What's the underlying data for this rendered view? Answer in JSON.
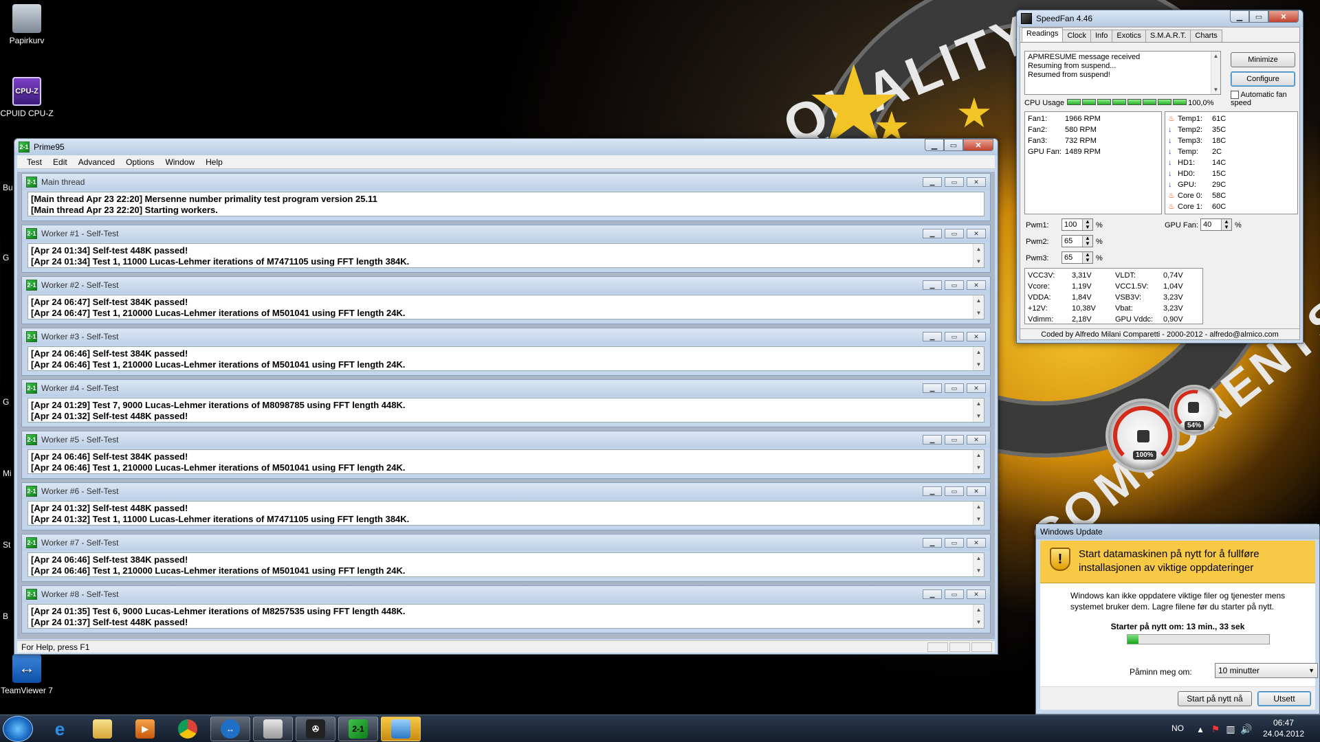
{
  "desktop": {
    "icons": [
      {
        "label": "Papirkurv",
        "icon": "recycle-bin-icon"
      },
      {
        "label": "CPUID CPU-Z",
        "icon": "cpuz-icon",
        "glyph": "CPU-Z"
      },
      {
        "label": "TeamViewer 7",
        "icon": "teamviewer-icon",
        "glyph": "↔"
      }
    ],
    "partial_labels": [
      "Bu",
      "G",
      "G",
      "Mi",
      "St",
      "B"
    ],
    "background_texts": [
      "QUALITY",
      "COMPONENTS"
    ]
  },
  "prime95": {
    "title": "Prime95",
    "app_glyph": "2-1",
    "menu": [
      "Test",
      "Edit",
      "Advanced",
      "Options",
      "Window",
      "Help"
    ],
    "status": "For Help, press F1",
    "windows": [
      {
        "title": "Main thread",
        "lines": [
          "[Main thread Apr 23 22:20] Mersenne number primality test program version 25.11",
          "[Main thread Apr 23 22:20] Starting workers."
        ]
      },
      {
        "title": "Worker #1 - Self-Test",
        "lines": [
          "[Apr 24 01:34] Self-test 448K passed!",
          "[Apr 24 01:34] Test 1, 11000 Lucas-Lehmer iterations of M7471105 using FFT length 384K."
        ]
      },
      {
        "title": "Worker #2 - Self-Test",
        "lines": [
          "[Apr 24 06:47] Self-test 384K passed!",
          "[Apr 24 06:47] Test 1, 210000 Lucas-Lehmer iterations of M501041 using FFT length 24K."
        ]
      },
      {
        "title": "Worker #3 - Self-Test",
        "lines": [
          "[Apr 24 06:46] Self-test 384K passed!",
          "[Apr 24 06:46] Test 1, 210000 Lucas-Lehmer iterations of M501041 using FFT length 24K."
        ]
      },
      {
        "title": "Worker #4 - Self-Test",
        "lines": [
          "[Apr 24 01:29] Test 7, 9000 Lucas-Lehmer iterations of M8098785 using FFT length 448K.",
          "[Apr 24 01:32] Self-test 448K passed!"
        ]
      },
      {
        "title": "Worker #5 - Self-Test",
        "lines": [
          "[Apr 24 06:46] Self-test 384K passed!",
          "[Apr 24 06:46] Test 1, 210000 Lucas-Lehmer iterations of M501041 using FFT length 24K."
        ]
      },
      {
        "title": "Worker #6 - Self-Test",
        "lines": [
          "[Apr 24 01:32] Self-test 448K passed!",
          "[Apr 24 01:32] Test 1, 11000 Lucas-Lehmer iterations of M7471105 using FFT length 384K."
        ]
      },
      {
        "title": "Worker #7 - Self-Test",
        "lines": [
          "[Apr 24 06:46] Self-test 384K passed!",
          "[Apr 24 06:46] Test 1, 210000 Lucas-Lehmer iterations of M501041 using FFT length 24K."
        ]
      },
      {
        "title": "Worker #8 - Self-Test",
        "lines": [
          "[Apr 24 01:35] Test 6, 9000 Lucas-Lehmer iterations of M8257535 using FFT length 448K.",
          "[Apr 24 01:37] Self-test 448K passed!"
        ]
      }
    ]
  },
  "speedfan": {
    "title": "SpeedFan 4.46",
    "tabs": [
      "Readings",
      "Clock",
      "Info",
      "Exotics",
      "S.M.A.R.T.",
      "Charts"
    ],
    "log": [
      "APMRESUME message received",
      "Resuming from suspend...",
      "Resumed from suspend!"
    ],
    "minimize_label": "Minimize",
    "configure_label": "Configure",
    "auto_fan_label": "Automatic fan speed",
    "cpu_usage_label": "CPU Usage",
    "cpu_usage_value": "100,0%",
    "cpu_usage_fraction": 1.0,
    "cpu_bars": 8,
    "fans": [
      {
        "name": "Fan1:",
        "value": "1966 RPM"
      },
      {
        "name": "Fan2:",
        "value": "580 RPM"
      },
      {
        "name": "Fan3:",
        "value": "732 RPM"
      },
      {
        "name": "GPU Fan:",
        "value": "1489 RPM"
      }
    ],
    "temps": [
      {
        "name": "Temp1:",
        "value": "61C",
        "trend": "flame-icon"
      },
      {
        "name": "Temp2:",
        "value": "35C",
        "trend": "down-arrow-icon"
      },
      {
        "name": "Temp3:",
        "value": "18C",
        "trend": "down-arrow-icon"
      },
      {
        "name": "Temp:",
        "value": "2C",
        "trend": "down-arrow-icon"
      },
      {
        "name": "HD1:",
        "value": "14C",
        "trend": "down-arrow-icon"
      },
      {
        "name": "HD0:",
        "value": "15C",
        "trend": "down-arrow-icon"
      },
      {
        "name": "GPU:",
        "value": "29C",
        "trend": "down-arrow-icon"
      },
      {
        "name": "Core 0:",
        "value": "58C",
        "trend": "flame-icon"
      },
      {
        "name": "Core 1:",
        "value": "60C",
        "trend": "flame-icon"
      }
    ],
    "pwm": [
      {
        "name": "Pwm1:",
        "value": "100",
        "unit": "%"
      },
      {
        "name": "Pwm2:",
        "value": "65",
        "unit": "%"
      },
      {
        "name": "Pwm3:",
        "value": "65",
        "unit": "%"
      }
    ],
    "gpu_fan": {
      "name": "GPU Fan:",
      "value": "40",
      "unit": "%"
    },
    "volts_left": [
      {
        "name": "VCC3V:",
        "value": "3,31V"
      },
      {
        "name": "Vcore:",
        "value": "1,19V"
      },
      {
        "name": "VDDA:",
        "value": "1,84V"
      },
      {
        "name": "+12V:",
        "value": "10,38V"
      },
      {
        "name": "Vdimm:",
        "value": "2,18V"
      }
    ],
    "volts_right": [
      {
        "name": "VLDT:",
        "value": "0,74V"
      },
      {
        "name": "VCC1.5V:",
        "value": "1,04V"
      },
      {
        "name": "VSB3V:",
        "value": "3,23V"
      },
      {
        "name": "Vbat:",
        "value": "3,23V"
      },
      {
        "name": "GPU Vddc:",
        "value": "0,90V"
      }
    ],
    "credit": "Coded by Alfredo Milani Comparetti - 2000-2012 - alfredo@almico.com"
  },
  "gadget": {
    "cpu_label": "100%",
    "cpu_fraction": 1.0,
    "mem_label": "54%",
    "mem_fraction": 0.54
  },
  "windows_update": {
    "title": "Windows Update",
    "header": "Start datamaskinen på nytt for å fullføre installasjonen av viktige oppdateringer",
    "description": "Windows kan ikke oppdatere viktige filer og tjenester mens systemet bruker dem. Lagre filene før du starter på nytt.",
    "countdown": "Starter på nytt om: 13 min., 33 sek",
    "progress_fraction": 0.08,
    "remind_label": "Påminn meg om:",
    "remind_value": "10 minutter",
    "restart_label": "Start på nytt nå",
    "postpone_label": "Utsett"
  },
  "taskbar": {
    "pinned": [
      "internet-explorer-icon",
      "explorer-folder-icon",
      "media-player-icon",
      "chrome-icon",
      "teamviewer-icon",
      "hardware-icon",
      "speedfan-icon",
      "prime95-icon",
      "windows-update-icon"
    ],
    "prime_glyph": "2-1",
    "language": "NO",
    "time": "06:47",
    "date": "24.04.2012"
  },
  "colors": {
    "accent_green": "#18a818",
    "update_yellow": "#f7c945",
    "flame": "#e03a00",
    "arrow_blue": "#1a3fd8"
  }
}
